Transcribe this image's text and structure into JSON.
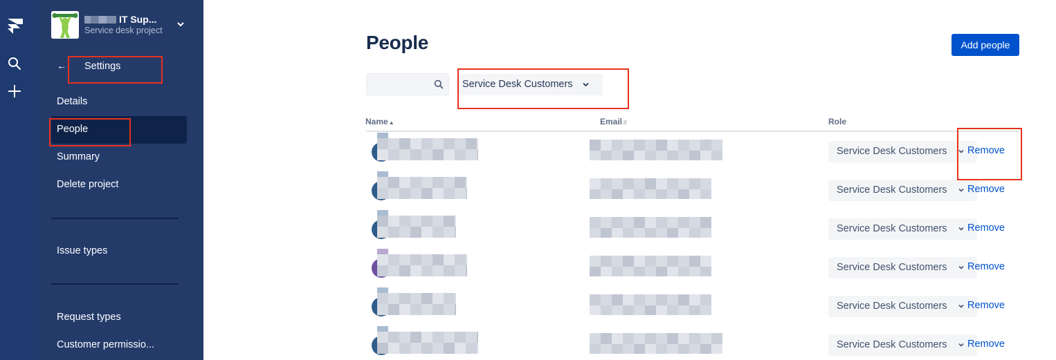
{
  "sidebar": {
    "project_name_suffix": "IT Sup...",
    "project_type": "Service desk project",
    "back_label": "Settings",
    "items": [
      {
        "label": "Details",
        "active": false
      },
      {
        "label": "People",
        "active": true
      },
      {
        "label": "Summary",
        "active": false
      },
      {
        "label": "Delete project",
        "active": false
      },
      {
        "label": "Issue types",
        "active": false
      },
      {
        "label": "Request types",
        "active": false
      },
      {
        "label": "Customer permissio...",
        "active": false
      }
    ]
  },
  "main": {
    "title": "People",
    "add_button": "Add people",
    "search": {
      "value": "",
      "placeholder": ""
    },
    "role_filter": "Service Desk Customers",
    "columns": {
      "name": "Name",
      "email": "Email",
      "role": "Role"
    },
    "rows": [
      {
        "avatar_color": "#2f5d8a",
        "role": "Service Desk Customers",
        "action": "Remove"
      },
      {
        "avatar_color": "#2f5d8a",
        "role": "Service Desk Customers",
        "action": "Remove"
      },
      {
        "avatar_color": "#2f5d8a",
        "role": "Service Desk Customers",
        "action": "Remove"
      },
      {
        "avatar_color": "#6e4fa0",
        "role": "Service Desk Customers",
        "action": "Remove"
      },
      {
        "avatar_color": "#2f5d8a",
        "role": "Service Desk Customers",
        "action": "Remove"
      },
      {
        "avatar_color": "#2f5d8a",
        "role": "Service Desk Customers",
        "action": "Remove"
      }
    ]
  },
  "colors": {
    "global_nav": "#1e3a6e",
    "sidebar": "#243b6a",
    "primary": "#0052cc",
    "annotation": "#e8311b"
  },
  "icons": [
    "jira-logo-icon",
    "search-icon",
    "plus-icon",
    "chevron-down-icon",
    "arrow-left-icon",
    "project-avatar-icon"
  ]
}
